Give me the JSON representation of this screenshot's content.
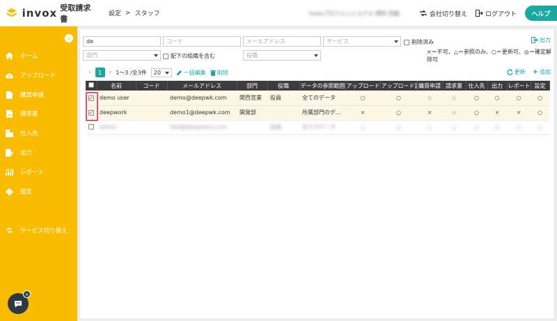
{
  "header": {
    "logo_text": "invox",
    "logo_sub": "受取請求書",
    "breadcrumb_1": "設定",
    "breadcrumb_sep": ">",
    "breadcrumb_2": "スタッフ",
    "company_blurred": "invoxプロフェッショナル 資料 別紙",
    "switch_company": "会社切り替え",
    "logout": "ログアウト",
    "help": "ヘルプ"
  },
  "sidebar": {
    "items": [
      {
        "label": "ホーム",
        "icon": "home-icon"
      },
      {
        "label": "アップロード",
        "icon": "cloud-upload-icon"
      },
      {
        "label": "購買申請",
        "icon": "document-icon"
      },
      {
        "label": "請求書",
        "icon": "invoice-icon"
      },
      {
        "label": "仕入先",
        "icon": "building-icon"
      },
      {
        "label": "出力",
        "icon": "export-icon"
      },
      {
        "label": "レポート",
        "icon": "chart-icon"
      },
      {
        "label": "設定",
        "icon": "gear-icon"
      }
    ],
    "service_switch": "サービス切り替え"
  },
  "filters": {
    "name_value": "de",
    "code_placeholder": "コード",
    "email_placeholder": "メールアドレス",
    "service_placeholder": "サービス",
    "deleted_label": "削除済み",
    "dept_placeholder": "部門",
    "include_sub_label": "配下の組織を含む",
    "role_placeholder": "役職",
    "export_label": "出力",
    "legend_text": "×＝不可、△＝参照のみ、○＝更新可、◎＝確定解除可"
  },
  "pager": {
    "current_page": "1",
    "summary": "1〜3 /全3件",
    "per_page": "20",
    "bulk_edit": "一括編集",
    "delete": "削除",
    "refresh": "更新",
    "add": "追加"
  },
  "table": {
    "columns": [
      "名前",
      "コード",
      "メールアドレス",
      "部門",
      "役職",
      "データの参照範囲",
      "アップロード",
      "アップロード設定",
      "購買申請",
      "請求書",
      "仕入先",
      "出力",
      "レポート",
      "設定"
    ],
    "rows": [
      {
        "checked": true,
        "name": "demo user",
        "code": "",
        "email": "demo@deepwk.com",
        "dept": "関西営業",
        "role": "役員",
        "scope": "全てのデータ",
        "perms": [
          "○",
          "○",
          "◎",
          "◎",
          "○",
          "○",
          "○",
          "○"
        ]
      },
      {
        "checked": true,
        "name": "deepwork",
        "code": "",
        "email": "demo1@deepwk.com",
        "dept": "開発部",
        "role": "",
        "scope": "所属部門のデータ",
        "perms": [
          "×",
          "○",
          "×",
          "◎",
          "○",
          "×",
          "×",
          "○"
        ]
      },
      {
        "checked": false,
        "name": "admin",
        "code": "",
        "email": "test@deepwork.com",
        "dept": "",
        "role": "役員",
        "scope": "全てのデータ",
        "perms": [
          "○",
          "○",
          "○",
          "○",
          "○",
          "○",
          "○",
          "○"
        ]
      }
    ]
  }
}
